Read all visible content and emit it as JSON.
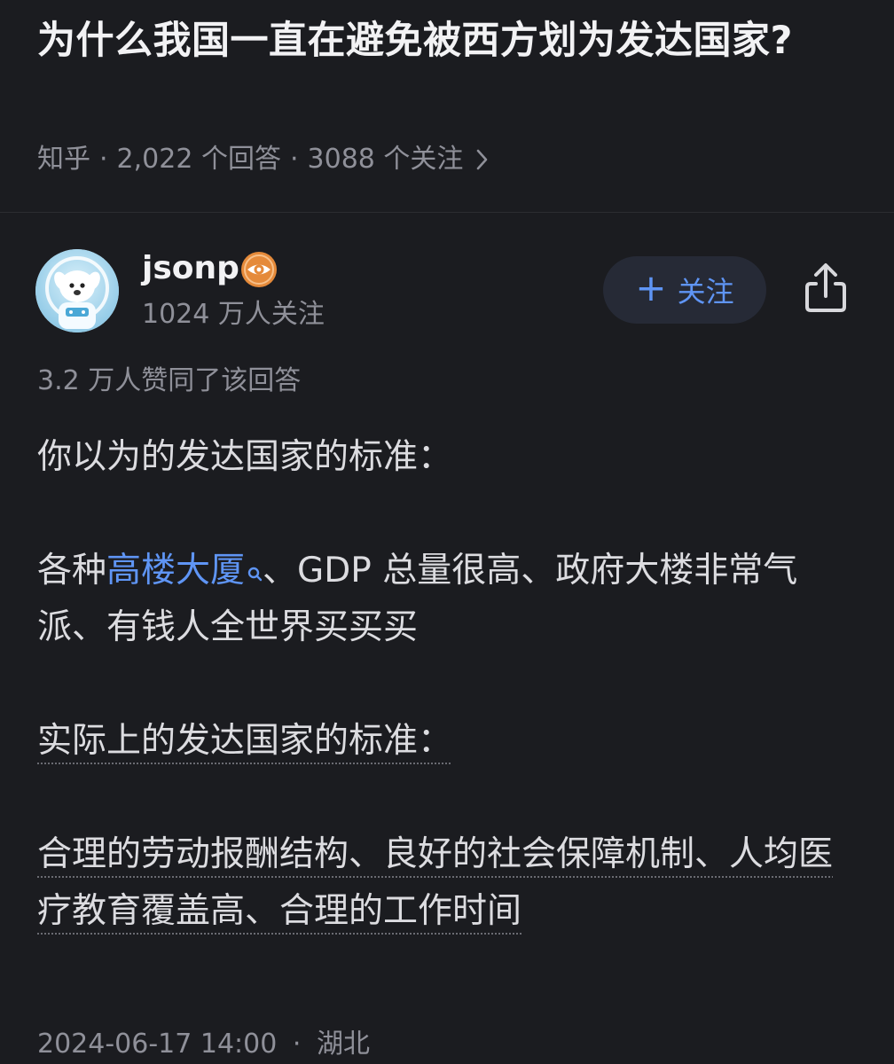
{
  "question": {
    "title": "为什么我国一直在避免被西方划为发达国家?",
    "meta": {
      "source": "知乎",
      "answers": "2,022 个回答",
      "followers": "3088 个关注",
      "separator": "·"
    }
  },
  "author": {
    "name": "jsonp",
    "followers": "1024 万人关注",
    "follow_label": "关注",
    "follow_plus": "+"
  },
  "answer": {
    "votes": "3.2 万人赞同了该回答",
    "p1": "你以为的发达国家的标准：",
    "p2_prefix": "各种",
    "p2_link": "高楼大厦",
    "p2_rest": "、GDP 总量很高、政府大楼非常气派、有钱人全世界买买买",
    "p3": "实际上的发达国家的标准：",
    "p4": "合理的劳动报酬结构、良好的社会保障机制、人均医疗教育覆盖高、合理的工作时间",
    "footer_time": "2024-06-17 14:00",
    "footer_sep": "·",
    "footer_location": "湖北"
  },
  "colors": {
    "background": "#1b1c20",
    "accent": "#5f95f5",
    "muted_text": "#8f9099",
    "badge": "#e58a3a"
  },
  "icons": {
    "chevron": "chevron-right-icon",
    "badge": "eye-badge-icon",
    "share": "share-icon",
    "search": "search-icon"
  }
}
